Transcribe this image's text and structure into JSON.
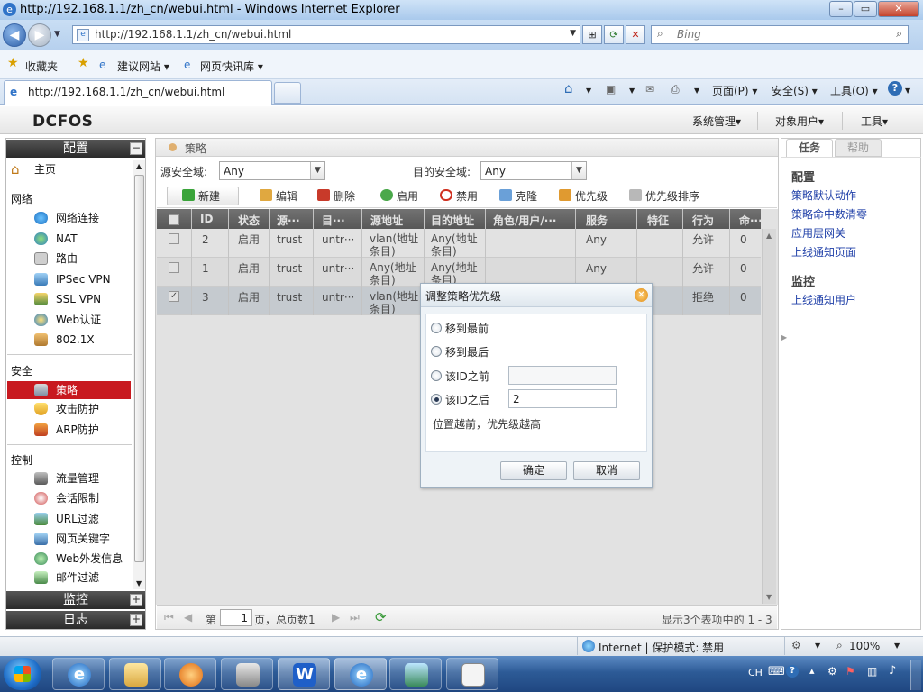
{
  "browser": {
    "title": "http://192.168.1.1/zh_cn/webui.html - Windows Internet Explorer",
    "url": "http://192.168.1.1/zh_cn/webui.html",
    "search_placeholder": "Bing",
    "favorites_label": "收藏夹",
    "fav_links": [
      "建议网站 ▾",
      "网页快讯库 ▾"
    ],
    "tab_title": "http://192.168.1.1/zh_cn/webui.html",
    "commands": [
      "页面(P) ▾",
      "安全(S) ▾",
      "工具(O) ▾"
    ]
  },
  "app": {
    "logo": "DCFOS",
    "top_menu": [
      "系统管理▾",
      "对象用户▾",
      "工具▾"
    ]
  },
  "sidebar": {
    "config_header": "配置",
    "home": "主页",
    "groups": {
      "network": "网络",
      "security": "安全",
      "control": "控制"
    },
    "network_items": [
      "网络连接",
      "NAT",
      "路由",
      "IPSec VPN",
      "SSL VPN",
      "Web认证",
      "802.1X"
    ],
    "security_items": [
      "策略",
      "攻击防护",
      "ARP防护"
    ],
    "control_items": [
      "流量管理",
      "会话限制",
      "URL过滤",
      "网页关键字",
      "Web外发信息",
      "邮件过滤"
    ],
    "monitor_header": "监控",
    "log_header": "日志",
    "plus": "+",
    "minus": "−"
  },
  "main": {
    "breadcrumb": "策略",
    "src_zone_label": "源安全域:",
    "src_zone_value": "Any",
    "dst_zone_label": "目的安全域:",
    "dst_zone_value": "Any",
    "toolbar": [
      "新建",
      "编辑",
      "删除",
      "启用",
      "禁用",
      "克隆",
      "优先级",
      "优先级排序"
    ],
    "columns": [
      "ID",
      "状态",
      "源···",
      "目···",
      "源地址",
      "目的地址",
      "角色/用户/···",
      "服务",
      "特征",
      "行为",
      "命···"
    ],
    "rows": [
      {
        "id": "2",
        "status": "启用",
        "src": "trust",
        "dst": "untr···",
        "src_addr": "vlan(地址条目)",
        "dst_addr": "Any(地址条目)",
        "role": "",
        "service": "Any",
        "feature": "",
        "action": "允许",
        "hits": "0",
        "checked": false
      },
      {
        "id": "1",
        "status": "启用",
        "src": "trust",
        "dst": "untr···",
        "src_addr": "Any(地址条目)",
        "dst_addr": "Any(地址条目)",
        "role": "",
        "service": "Any",
        "feature": "",
        "action": "允许",
        "hits": "0",
        "checked": false
      },
      {
        "id": "3",
        "status": "启用",
        "src": "trust",
        "dst": "untr···",
        "src_addr": "vlan(地址条目)",
        "dst_addr": "",
        "role": "",
        "service": "",
        "feature": "",
        "action": "拒绝",
        "hits": "0",
        "checked": true
      }
    ],
    "pager": {
      "page_prefix": "第",
      "page_value": "1",
      "page_suffix": "页，总页数1",
      "summary": "显示3个表项中的 1 - 3"
    }
  },
  "right_panel": {
    "tabs": [
      "任务",
      "帮助"
    ],
    "config_title": "配置",
    "config_links": [
      "策略默认动作",
      "策略命中数清零",
      "应用层网关",
      "上线通知页面"
    ],
    "monitor_title": "监控",
    "monitor_links": [
      "上线通知用户"
    ]
  },
  "dialog": {
    "title": "调整策略优先级",
    "options": [
      "移到最前",
      "移到最后",
      "该ID之前",
      "该ID之后"
    ],
    "selected_index": 3,
    "before_id_value": "",
    "after_id_value": "2",
    "hint": "位置越前，优先级越高",
    "ok": "确定",
    "cancel": "取消"
  },
  "statusbar": {
    "zone": "Internet | 保护模式: 禁用",
    "zoom": "100%"
  },
  "taskbar": {
    "lang": "CH"
  },
  "colors": {
    "selected_nav": "#c8191f",
    "link": "#2040a8",
    "grid_header": "#555555"
  }
}
